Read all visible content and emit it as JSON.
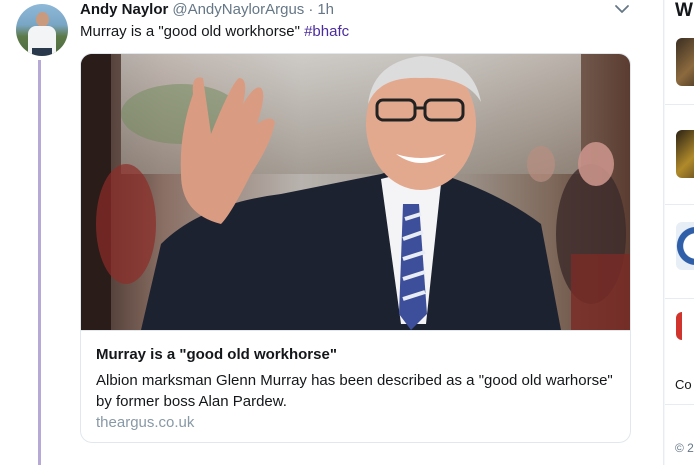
{
  "tweet": {
    "display_name": "Andy Naylor",
    "handle": "@AndyNaylorArgus",
    "separator": "·",
    "time": "1h",
    "text": "Murray is a \"good old workhorse\"",
    "hashtag": "#bhafc"
  },
  "card": {
    "title": "Murray is a \"good old workhorse\"",
    "description": "Albion marksman Glenn Murray has been described as a \"good old warhorse\" by former boss Alan Pardew.",
    "domain": "theargus.co.uk"
  },
  "sidebar": {
    "heading": "W",
    "item_text_1": "Co",
    "item_text_2": "© 2"
  },
  "colors": {
    "hashtag": "#4b2c9e",
    "thread_line": "#b7a9d6",
    "secondary_text": "#657786",
    "domain_text": "#8899a6",
    "sidebar_accent": "#d0342c"
  },
  "icons": [
    "chevron-down-icon"
  ]
}
